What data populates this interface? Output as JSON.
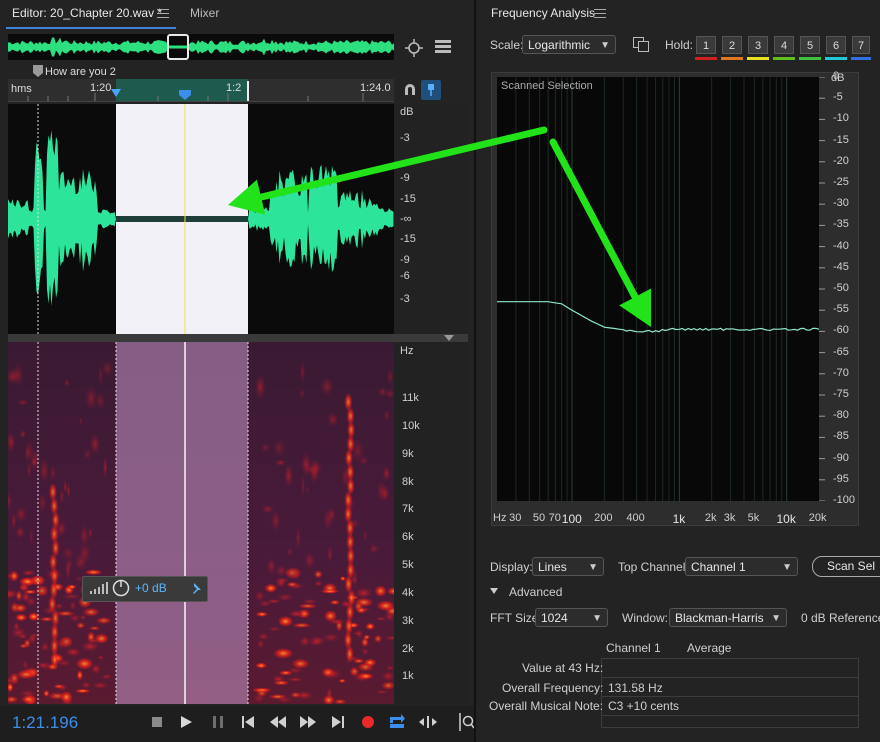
{
  "editor": {
    "tab_title": "Editor: 20_Chapter 20.wav *",
    "mixer_tab": "Mixer",
    "marker_label": "How are you 2",
    "ruler_unit": "hms",
    "ruler_ticks": [
      "1:20",
      "1:2",
      "1:24.0"
    ],
    "db_scale_top": [
      "dB",
      "-3",
      "-9",
      "-15",
      "-∞"
    ],
    "db_scale_bottom": [
      "-15",
      "-9",
      "-6",
      "-3"
    ],
    "hz_scale": [
      "Hz",
      "11k",
      "10k",
      "9k",
      "8k",
      "7k",
      "6k",
      "5k",
      "4k",
      "3k",
      "2k",
      "1k"
    ],
    "hud_gain": "+0 dB",
    "timecode": "1:21.196"
  },
  "frequency_analysis": {
    "title": "Frequency Analysis",
    "scale_label": "Scale:",
    "scale_value": "Logarithmic",
    "hold_label": "Hold:",
    "hold_buttons": [
      "1",
      "2",
      "3",
      "4",
      "5",
      "6",
      "7"
    ],
    "hold_colors": [
      "#d02020",
      "#e07820",
      "#e8e020",
      "#60c020",
      "#40c040",
      "#20c8d8",
      "#3070e0"
    ],
    "plot_title": "Scanned Selection",
    "y_axis": [
      "dB",
      "0",
      "-5",
      "-10",
      "-15",
      "-20",
      "-25",
      "-30",
      "-35",
      "-40",
      "-45",
      "-50",
      "-55",
      "-60",
      "-65",
      "-70",
      "-75",
      "-80",
      "-85",
      "-90",
      "-95",
      "-100"
    ],
    "x_axis": [
      "Hz",
      "30",
      "50",
      "70",
      "100",
      "200",
      "400",
      "1k",
      "2k",
      "3k",
      "5k",
      "10k",
      "20k"
    ],
    "display_label": "Display:",
    "display_value": "Lines",
    "top_channel_label": "Top Channel:",
    "top_channel_value": "Channel 1",
    "scan_button": "Scan Sel",
    "advanced_label": "Advanced",
    "fft_label": "FFT Size:",
    "fft_value": "1024",
    "window_label": "Window:",
    "window_value": "Blackman-Harris",
    "reference_label": "0 dB Reference",
    "table_headers": [
      "Channel 1",
      "Average"
    ],
    "rows": [
      {
        "label": "Value at 43 Hz:",
        "value": ""
      },
      {
        "label": "Overall Frequency:",
        "value": "131.58 Hz"
      },
      {
        "label": "Overall Musical Note:",
        "value": "C3 +10 cents"
      }
    ]
  },
  "chart_data": {
    "type": "line",
    "title": "Scanned Selection",
    "x_scale": "log",
    "xlim": [
      20,
      20000
    ],
    "ylim": [
      -100,
      0
    ],
    "xlabel": "Hz",
    "ylabel": "dB",
    "x": [
      20,
      40,
      60,
      80,
      100,
      150,
      200,
      300,
      400,
      600,
      800,
      1000,
      2000,
      4000,
      8000,
      20000
    ],
    "values": [
      -53,
      -53,
      -53,
      -53.5,
      -55,
      -57.5,
      -59,
      -59.6,
      -60,
      -60,
      -59.5,
      -59.5,
      -59.5,
      -59.5,
      -59.6,
      -59.5
    ]
  },
  "annotation": {
    "arrow_color": "#22e21a"
  }
}
